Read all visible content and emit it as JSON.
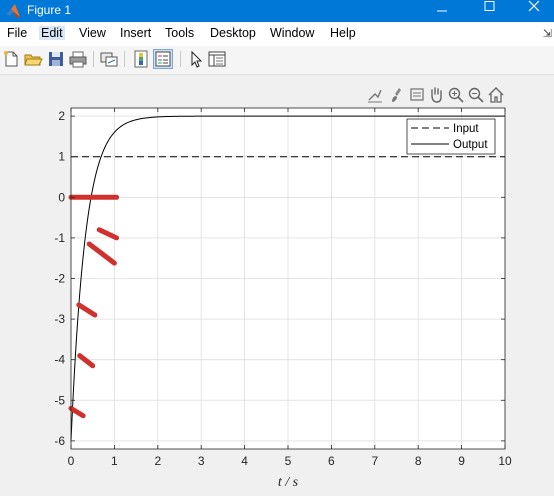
{
  "window": {
    "title": "Figure 1",
    "icon": "matlab-logo-icon",
    "controls": [
      "minimize-icon",
      "maximize-icon",
      "close-icon"
    ]
  },
  "menu": {
    "items": [
      "File",
      "Edit",
      "View",
      "Insert",
      "Tools",
      "Desktop",
      "Window",
      "Help"
    ],
    "active": "Edit"
  },
  "toolbar": {
    "icons": [
      "new-figure-icon",
      "open-file-icon",
      "save-icon",
      "print-icon",
      "link-plot-icon",
      "colorbar-icon",
      "legend-icon",
      "edit-plot-icon",
      "property-inspector-icon"
    ]
  },
  "axes_toolbar": {
    "icons": [
      "export-icon",
      "brush-icon",
      "data-tips-icon",
      "pan-icon",
      "zoom-in-icon",
      "zoom-out-icon",
      "home-icon"
    ]
  },
  "chart_data": {
    "type": "line",
    "title": "",
    "xlabel": "t / s",
    "ylabel": "",
    "xlim": [
      0,
      10
    ],
    "ylim": [
      -6.2,
      2.2
    ],
    "xticks": [
      0,
      1,
      2,
      3,
      4,
      5,
      6,
      7,
      8,
      9,
      10
    ],
    "yticks": [
      -6,
      -5,
      -4,
      -3,
      -2,
      -1,
      0,
      1,
      2
    ],
    "grid": true,
    "legend_position": "top-right",
    "series": [
      {
        "name": "Input",
        "style": "dashed",
        "color": "#000000",
        "x": [
          0,
          10
        ],
        "y": [
          1,
          1
        ]
      },
      {
        "name": "Output",
        "style": "solid",
        "color": "#000000",
        "model": "y = 2 - 8*exp(-3t)",
        "y0": -6,
        "yinf": 2,
        "rate": 3
      }
    ],
    "annotations": {
      "color": "#d0312d",
      "segments": [
        {
          "x1": 0.0,
          "y1": 0.0,
          "x2": 1.05,
          "y2": 0.0
        },
        {
          "x1": 0.65,
          "y1": -0.8,
          "x2": 1.05,
          "y2": -1.0
        },
        {
          "x1": 0.42,
          "y1": -1.15,
          "x2": 1.0,
          "y2": -1.62
        },
        {
          "x1": 0.18,
          "y1": -2.65,
          "x2": 0.55,
          "y2": -2.9
        },
        {
          "x1": 0.2,
          "y1": -3.9,
          "x2": 0.5,
          "y2": -4.15
        },
        {
          "x1": 0.0,
          "y1": -5.2,
          "x2": 0.28,
          "y2": -5.38
        }
      ]
    }
  }
}
